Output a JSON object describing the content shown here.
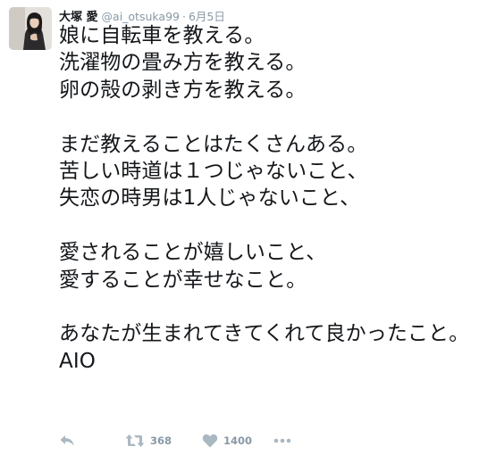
{
  "tweet": {
    "author": {
      "name": "大塚 愛",
      "handle": "@ai_otsuka99"
    },
    "separator": "·",
    "date": "6月5日",
    "text": "娘に自転車を教える。\n洗濯物の畳み方を教える。\n卵の殻の剥き方を教える。\n\nまだ教えることはたくさんある。\n苦しい時道は１つじゃないこと、\n失恋の時男は1人じゃないこと、\n\n愛されることが嬉しいこと、\n愛することが幸せなこと。\n\nあなたが生まれてきてくれて良かったこと。\nAIO"
  },
  "actions": {
    "reply_icon": "reply-icon",
    "retweet_icon": "retweet-icon",
    "retweet_count": "368",
    "like_icon": "heart-icon",
    "like_count": "1400",
    "more_icon": "more-icon"
  },
  "colors": {
    "text": "#14171a",
    "muted": "#8899a6",
    "background": "#ffffff"
  }
}
